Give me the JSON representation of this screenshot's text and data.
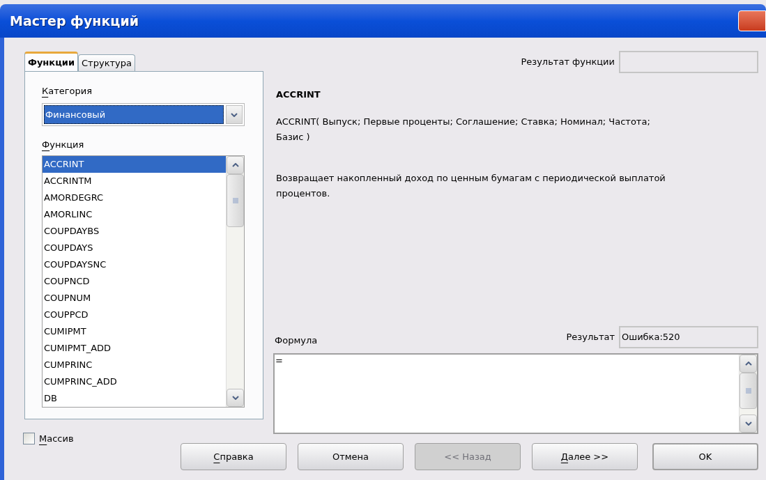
{
  "window": {
    "title": "Мастер функций"
  },
  "tabs": [
    {
      "label": "Функции",
      "selected": true
    },
    {
      "label": "Структура",
      "selected": false
    }
  ],
  "category": {
    "label": "Категория",
    "mnemonic": true,
    "value": "Финансовый"
  },
  "function_list": {
    "label": "Функция",
    "mnemonic": true,
    "items": [
      {
        "label": "ACCRINT",
        "selected": true
      },
      {
        "label": "ACCRINTM",
        "selected": false
      },
      {
        "label": "AMORDEGRC",
        "selected": false
      },
      {
        "label": "AMORLINC",
        "selected": false
      },
      {
        "label": "COUPDAYBS",
        "selected": false
      },
      {
        "label": "COUPDAYS",
        "selected": false
      },
      {
        "label": "COUPDAYSNC",
        "selected": false
      },
      {
        "label": "COUPNCD",
        "selected": false
      },
      {
        "label": "COUPNUM",
        "selected": false
      },
      {
        "label": "COUPPCD",
        "selected": false
      },
      {
        "label": "CUMIPMT",
        "selected": false
      },
      {
        "label": "CUMIPMT_ADD",
        "selected": false
      },
      {
        "label": "CUMPRINC",
        "selected": false
      },
      {
        "label": "CUMPRINC_ADD",
        "selected": false
      },
      {
        "label": "DB",
        "selected": false
      }
    ]
  },
  "function_result": {
    "label": "Результат функции"
  },
  "function_name": "ACCRINT",
  "syntax": "ACCRINT( Выпуск; Первые проценты; Соглашение; Ставка; Номинал; Частота; Базис )",
  "description": "Возвращает накопленный доход по ценным бумагам с периодической выплатой процентов.",
  "formula": {
    "label": "Формула",
    "value": "="
  },
  "result": {
    "label": "Результат",
    "value": "Ошибка:520"
  },
  "array_checkbox": {
    "label": "Массив",
    "mnemonic": true,
    "checked": false
  },
  "buttons": [
    {
      "label": "Справка",
      "mnemonic": true,
      "disabled": false,
      "default": false
    },
    {
      "label": "Отмена",
      "mnemonic": false,
      "disabled": false,
      "default": false
    },
    {
      "label": "<< Назад",
      "mnemonic": false,
      "disabled": true,
      "default": false
    },
    {
      "label": "Далее >>",
      "mnemonic": true,
      "disabled": false,
      "default": false
    },
    {
      "label": "OK",
      "mnemonic": false,
      "disabled": false,
      "default": true
    }
  ]
}
